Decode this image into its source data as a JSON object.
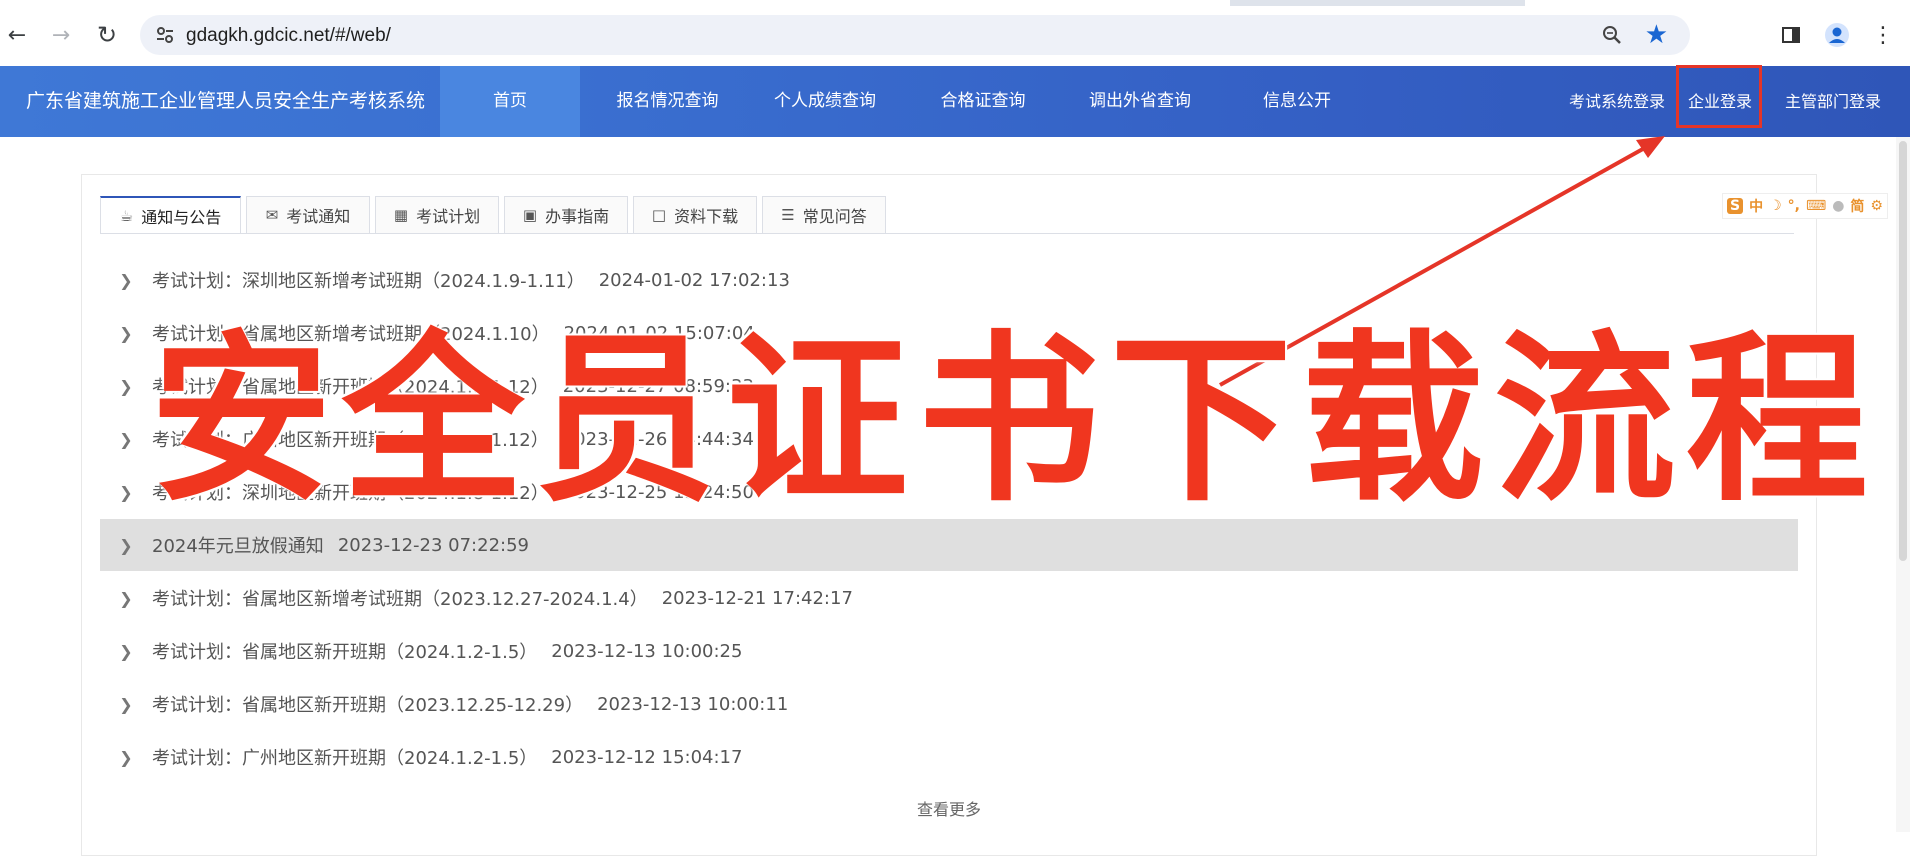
{
  "browser": {
    "url": "gdagkh.gdcic.net/#/web/",
    "accent": "#1a66d2"
  },
  "site": {
    "title": "广东省建筑施工企业管理人员安全生产考核系统",
    "nav": [
      "首页",
      "报名情况查询",
      "个人成绩查询",
      "合格证查询",
      "调出外省查询",
      "信息公开"
    ],
    "logins": [
      "考试系统登录",
      "企业登录",
      "主管部门登录"
    ],
    "header_color": "#3a6fd0"
  },
  "tabs": [
    {
      "label": "通知与公告",
      "icon": "bell-icon"
    },
    {
      "label": "考试通知",
      "icon": "megaphone-icon"
    },
    {
      "label": "考试计划",
      "icon": "calendar-icon"
    },
    {
      "label": "办事指南",
      "icon": "grid-icon"
    },
    {
      "label": "资料下载",
      "icon": "document-icon"
    },
    {
      "label": "常见问答",
      "icon": "list-icon"
    }
  ],
  "notices": [
    {
      "title": "考试计划：深圳地区新增考试班期（2024.1.9-1.11）",
      "time": "2024-01-02 17:02:13"
    },
    {
      "title": "考试计划：省属地区新增考试班期（2024.1.10）",
      "time": "2024-01-02 15:07:04"
    },
    {
      "title": "考试计划：省属地区新开班期（2024.1.8-1.12）",
      "time": "2023-12-27 08:59:33"
    },
    {
      "title": "考试计划：广州地区新开班期（2024.1.8-1.12）",
      "time": "2023-12-26 14:44:34"
    },
    {
      "title": "考试计划：深圳地区新开班期（2024.1.8-1.12）",
      "time": "2023-12-25 15:24:50"
    },
    {
      "title": "2024年元旦放假通知",
      "time": "2023-12-23 07:22:59"
    },
    {
      "title": "考试计划：省属地区新增考试班期（2023.12.27-2024.1.4）",
      "time": "2023-12-21 17:42:17"
    },
    {
      "title": "考试计划：省属地区新开班期（2024.1.2-1.5）",
      "time": "2023-12-13 10:00:25"
    },
    {
      "title": "考试计划：省属地区新开班期（2023.12.25-12.29）",
      "time": "2023-12-13 10:00:11"
    },
    {
      "title": "考试计划：广州地区新开班期（2024.1.2-1.5）",
      "time": "2023-12-12 15:04:17"
    }
  ],
  "more_label": "查看更多",
  "ime": {
    "items": [
      "中",
      "简"
    ]
  },
  "overlay_caption": "安全员证书下载流程",
  "annotation_color": "#e53528"
}
